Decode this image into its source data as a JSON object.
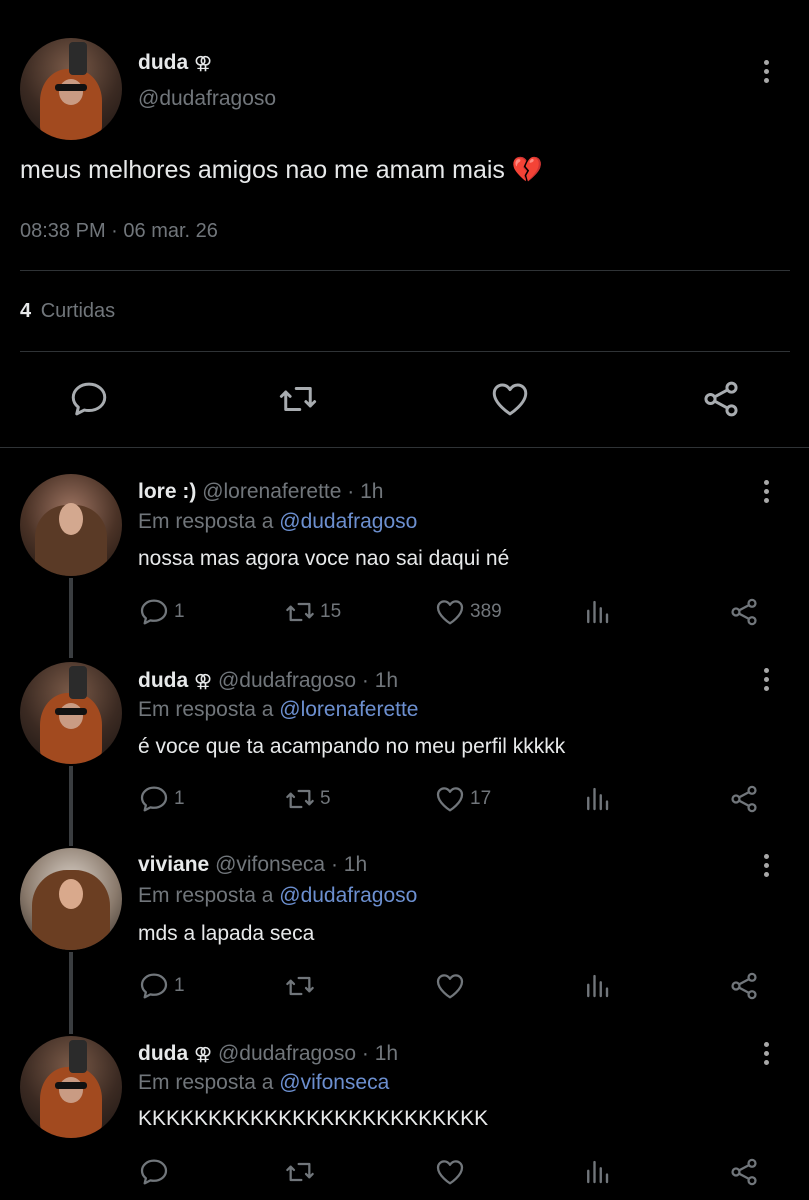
{
  "main_tweet": {
    "name": "duda",
    "gender_symbol": "⚢",
    "handle": "@dudafragoso",
    "text": "meus melhores amigos nao me amam mais",
    "emoji": "💔",
    "time": "08:38 PM",
    "separator": "·",
    "date": "06 mar. 26",
    "likes_count": "4",
    "likes_label": "Curtidas"
  },
  "replies": [
    {
      "name": "lore :)",
      "handle": "@lorenaferette",
      "age": "· 1h",
      "reply_prefix": "Em resposta a",
      "reply_to": "@dudafragoso",
      "text": "nossa mas agora voce nao sai daqui né",
      "comments": "1",
      "retweets": "15",
      "likes": "389"
    },
    {
      "name": "duda",
      "gender_symbol": "⚢",
      "handle": "@dudafragoso",
      "age": "· 1h",
      "reply_prefix": "Em resposta a",
      "reply_to": "@lorenaferette",
      "text": "é voce que ta acampando no meu perfil kkkkk",
      "comments": "1",
      "retweets": "5",
      "likes": "17"
    },
    {
      "name": "viviane",
      "handle": "@vifonseca",
      "age": "· 1h",
      "reply_prefix": "Em resposta a",
      "reply_to": "@dudafragoso",
      "text": "mds a lapada seca",
      "comments": "1",
      "retweets": "",
      "likes": ""
    },
    {
      "name": "duda",
      "gender_symbol": "⚢",
      "handle": "@dudafragoso",
      "age": "· 1h",
      "reply_prefix": "Em resposta a",
      "reply_to": "@vifonseca",
      "text": "KKKKKKKKKKKKKKKKKKKKKKKKK",
      "comments": "",
      "retweets": "",
      "likes": ""
    }
  ],
  "icons": {
    "comment": "comment-icon",
    "retweet": "retweet-icon",
    "like": "heart-icon",
    "views": "views-icon",
    "share": "share-icon",
    "more": "more-options-icon"
  },
  "colors": {
    "background": "#000000",
    "text": "#e7e9ea",
    "muted": "#71767b",
    "link": "#6c8fcf"
  }
}
